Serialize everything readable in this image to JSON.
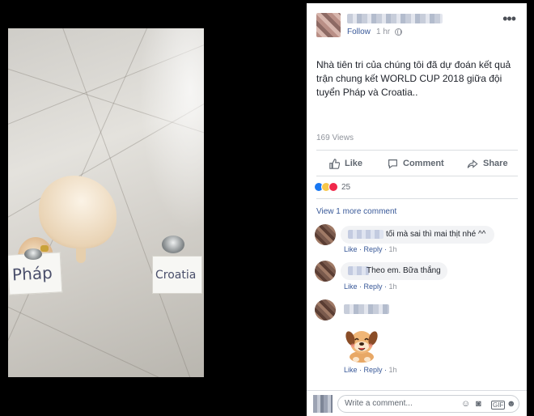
{
  "video": {
    "sign_left": "Pháp",
    "sign_right": "Croatia"
  },
  "post": {
    "follow_label": "Follow",
    "time": "1 hr",
    "more_label": "•••",
    "caption": "Nhà tiên tri của chúng tôi đã dự đoán kết quả trận chung kết WORLD CUP 2018 giữa đội tuyển Pháp và Croatia..",
    "views": "169 Views",
    "actions": {
      "like": "Like",
      "comment": "Comment",
      "share": "Share"
    },
    "reaction_count": "25",
    "view_more": "View 1 more comment",
    "comments": [
      {
        "text": "tối mà sai thì mai thịt nhé ^^",
        "like": "Like",
        "reply": "Reply",
        "time": "1h"
      },
      {
        "text": "Theo em. Bữa thắng",
        "like": "Like",
        "reply": "Reply",
        "time": "1h"
      },
      {
        "text": "",
        "like": "Like",
        "reply": "Reply",
        "time": "1h"
      }
    ],
    "write_placeholder": "Write a comment..."
  },
  "colors": {
    "link": "#385898",
    "like_blue": "#1877f2",
    "love_red": "#f0284a",
    "haha_yellow": "#f7c74a"
  }
}
